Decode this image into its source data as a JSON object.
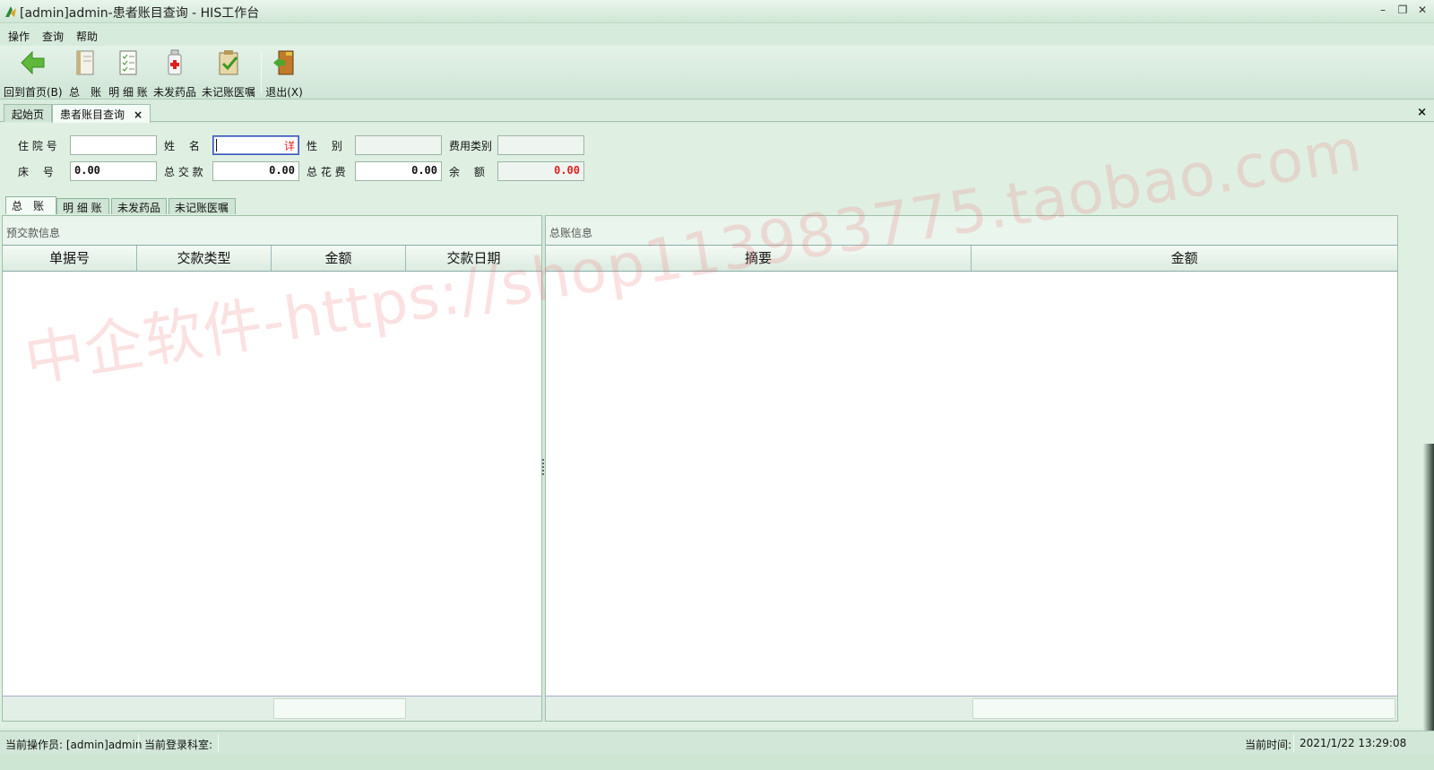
{
  "window": {
    "title": "[admin]admin-患者账目查询 - HIS工作台"
  },
  "menu": {
    "items": [
      "操作",
      "查询",
      "帮助"
    ]
  },
  "toolbar": {
    "home": "回到首页(B)",
    "ledger": "总　账",
    "detail": "明 细 账",
    "undispensed": "未发药品",
    "unrecorded": "未记账医嘱",
    "exit": "退出(X)"
  },
  "doc_tabs": {
    "start": "起始页",
    "current": "患者账目查询",
    "close_glyph": "×"
  },
  "form": {
    "admission_no_label": "住 院 号",
    "admission_no": "",
    "name_label": "姓　 名",
    "name_detail": "详",
    "gender_label": "性　 别",
    "gender": "",
    "fee_type_label": "费用类别",
    "fee_type": "",
    "bed_label": "床　 号",
    "bed": "0.00",
    "total_paid_label": "总 交 款",
    "total_paid": "0.00",
    "total_cost_label": "总 花 费",
    "total_cost": "0.00",
    "balance_label": "余　 额",
    "balance": "0.00"
  },
  "sub_tabs": [
    "总　账",
    "明 细 账",
    "未发药品",
    "未记账医嘱"
  ],
  "left_panel": {
    "title": "预交款信息",
    "columns": [
      "单据号",
      "交款类型",
      "金额",
      "交款日期"
    ]
  },
  "right_panel": {
    "title": "总账信息",
    "columns": [
      "摘要",
      "金额"
    ]
  },
  "status": {
    "operator": "当前操作员: [admin]admin",
    "department": "当前登录科室:",
    "time_label": "当前时间:",
    "time": "2021/1/22 13:29:08"
  },
  "watermark": "中企软件-https://shop113983775.taobao.com",
  "colors": {
    "accent_red": "#e02020",
    "bg_green": "#d9ecde"
  }
}
